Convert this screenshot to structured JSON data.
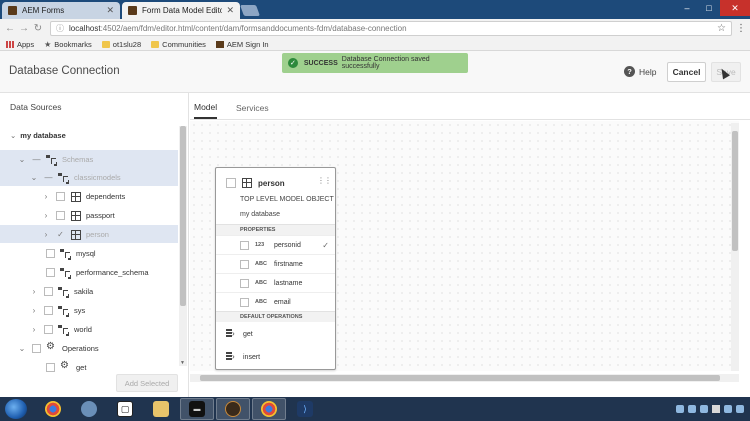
{
  "browser": {
    "tabs": [
      {
        "title": "AEM Forms",
        "active": false
      },
      {
        "title": "Form Data Model Editor",
        "active": true
      }
    ],
    "url_host": "localhost",
    "url_path": ":4502/aem/fdm/editor.html/content/dam/formsanddocuments-fdm/database-connection",
    "bookmarks": [
      "Apps",
      "Bookmarks",
      "ot1slu28",
      "Communities",
      "AEM Sign In"
    ],
    "window_controls": {
      "minimize": "–",
      "maximize": "□",
      "close": "✕"
    }
  },
  "header": {
    "title": "Database Connection",
    "toast": {
      "status": "SUCCESS",
      "message": "Database Connection saved successfully"
    },
    "help_label": "Help",
    "cancel_label": "Cancel",
    "save_label": "Save"
  },
  "data_sources": {
    "title": "Data Sources",
    "root_label": "my database",
    "tree": [
      {
        "label": "Schemas",
        "icon": "schema-icon",
        "expanded": true,
        "selected": true,
        "faded": true
      },
      {
        "label": "classicmodels",
        "icon": "schema-icon",
        "expanded": true,
        "selected": true,
        "faded": true
      },
      {
        "label": "dependents",
        "icon": "table-icon",
        "expandable": true
      },
      {
        "label": "passport",
        "icon": "table-icon",
        "expandable": true
      },
      {
        "label": "person",
        "icon": "table-icon",
        "expandable": true,
        "selected": true,
        "faded": true,
        "checked": true
      },
      {
        "label": "mysql",
        "icon": "schema-icon"
      },
      {
        "label": "performance_schema",
        "icon": "schema-icon"
      },
      {
        "label": "sakila",
        "icon": "schema-icon",
        "expandable": true
      },
      {
        "label": "sys",
        "icon": "schema-icon",
        "expandable": true
      },
      {
        "label": "world",
        "icon": "schema-icon",
        "expandable": true
      },
      {
        "label": "Operations",
        "icon": "operations-icon",
        "expanded": true
      },
      {
        "label": "get",
        "icon": "operation-icon"
      }
    ],
    "add_selected_label": "Add Selected"
  },
  "main": {
    "tabs": [
      {
        "label": "Model",
        "active": true
      },
      {
        "label": "Services",
        "active": false
      }
    ]
  },
  "entity": {
    "name": "person",
    "subtitle": "TOP LEVEL MODEL OBJECT",
    "source": "my database",
    "properties_header": "PROPERTIES",
    "properties": [
      {
        "type": "123",
        "name": "personid",
        "checked": true
      },
      {
        "type": "ABC",
        "name": "firstname",
        "checked": false
      },
      {
        "type": "ABC",
        "name": "lastname",
        "checked": false
      },
      {
        "type": "ABC",
        "name": "email",
        "checked": false
      }
    ],
    "operations_header": "DEFAULT OPERATIONS",
    "operations": [
      "get",
      "insert"
    ]
  },
  "taskbar": {
    "apps": [
      "chrome-icon",
      "magnifier-icon",
      "brackets-icon",
      "file-explorer-icon",
      "terminal-icon",
      "server-icon",
      "chrome-icon",
      "visual-studio-code-icon"
    ]
  }
}
